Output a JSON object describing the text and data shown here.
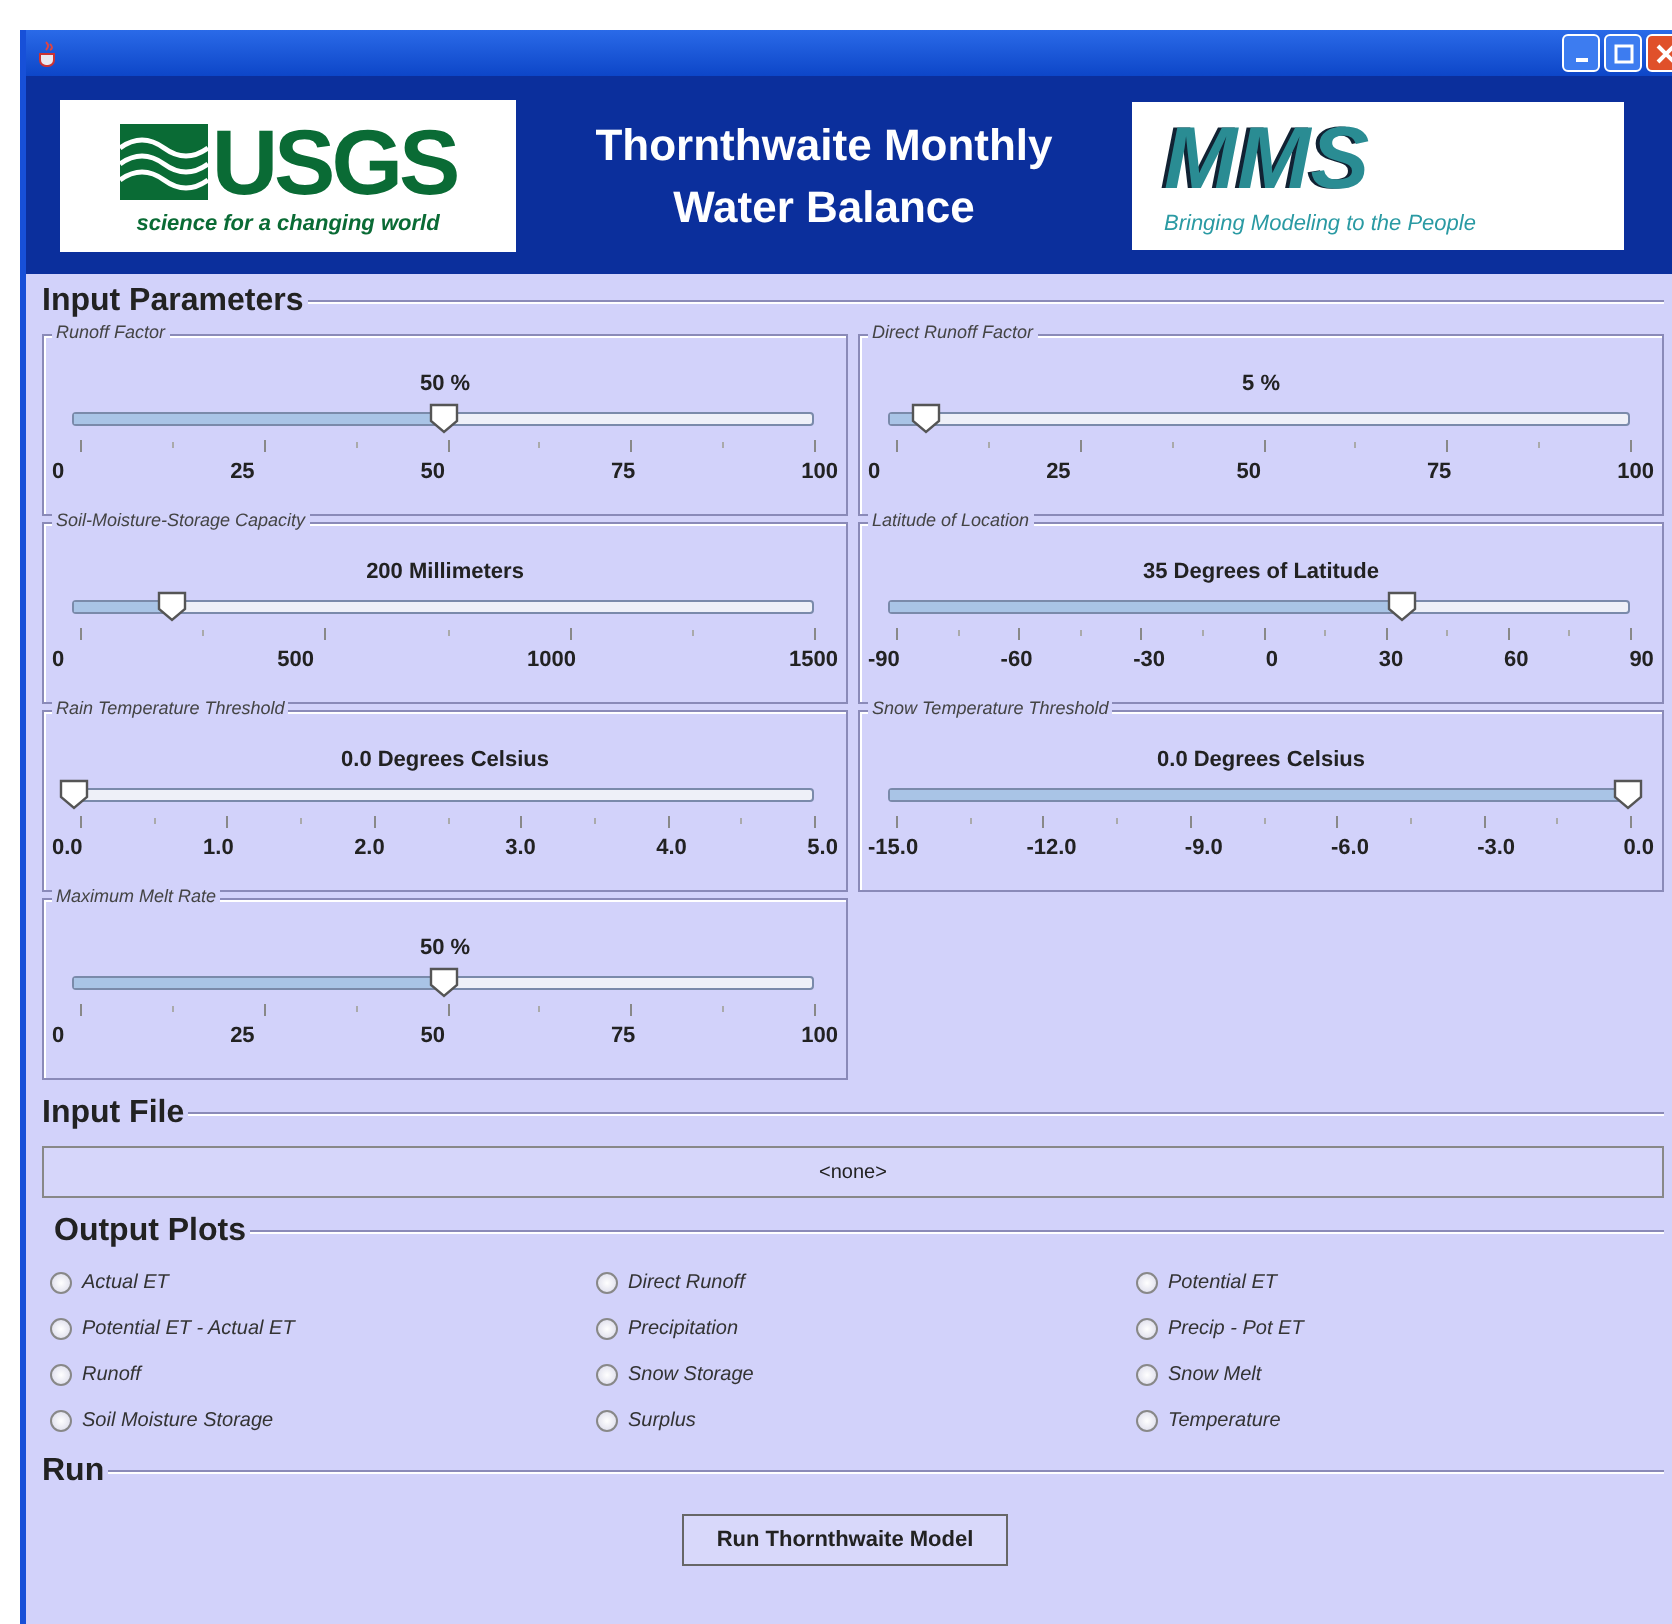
{
  "header": {
    "logo_left": {
      "name": "USGS",
      "tagline": "science for a changing world"
    },
    "title_lines": [
      "Thornthwaite Monthly",
      "Water Balance"
    ],
    "logo_right": {
      "name": "MMS",
      "tagline": "Bringing Modeling to the People"
    }
  },
  "input_parameters": {
    "title": "Input Parameters",
    "sliders": [
      {
        "label": "Runoff Factor",
        "reading": "50  %",
        "level": 0.5,
        "ticks": [
          "0",
          "25",
          "50",
          "75",
          "100"
        ]
      },
      {
        "label": "Direct Runoff Factor",
        "reading": "5  %",
        "level": 0.05,
        "ticks": [
          "0",
          "25",
          "50",
          "75",
          "100"
        ]
      },
      {
        "label": "Soil-Moisture-Storage Capacity",
        "reading": "200 Millimeters",
        "level": 0.133,
        "ticks": [
          "0",
          "500",
          "1000",
          "1500"
        ]
      },
      {
        "label": "Latitude of Location",
        "reading": "35 Degrees of Latitude",
        "level": 0.694,
        "ticks": [
          "-90",
          "-60",
          "-30",
          "0",
          "30",
          "60",
          "90"
        ]
      },
      {
        "label": "Rain Temperature Threshold",
        "reading": "0.0 Degrees Celsius",
        "level": 0,
        "ticks": [
          "0.0",
          "1.0",
          "2.0",
          "3.0",
          "4.0",
          "5.0"
        ]
      },
      {
        "label": "Snow Temperature Threshold",
        "reading": "0.0 Degrees Celsius",
        "level": 1,
        "ticks": [
          "-15.0",
          "-12.0",
          "-9.0",
          "-6.0",
          "-3.0",
          "0.0"
        ]
      },
      {
        "label": "Maximum Melt Rate",
        "reading": "50 %",
        "level": 0.5,
        "ticks": [
          "0",
          "25",
          "50",
          "75",
          "100"
        ]
      }
    ]
  },
  "input_file": {
    "title": "Input File",
    "value": "<none>"
  },
  "output_plots": {
    "title": "Output Plots",
    "options": [
      {
        "label": "Actual ET",
        "selected": false
      },
      {
        "label": "Direct Runoff",
        "selected": false
      },
      {
        "label": "Potential ET",
        "selected": false
      },
      {
        "label": "Potential ET - Actual ET",
        "selected": false
      },
      {
        "label": "Precipitation",
        "selected": false
      },
      {
        "label": "Precip - Pot ET",
        "selected": false
      },
      {
        "label": "Runoff",
        "selected": false
      },
      {
        "label": "Snow Storage",
        "selected": false
      },
      {
        "label": "Snow Melt",
        "selected": false
      },
      {
        "label": "Soil Moisture Storage",
        "selected": false
      },
      {
        "label": "Surplus",
        "selected": false
      },
      {
        "label": "Temperature",
        "selected": false
      }
    ]
  },
  "run": {
    "title": "Run",
    "button": "Run Thornthwaite Model"
  }
}
